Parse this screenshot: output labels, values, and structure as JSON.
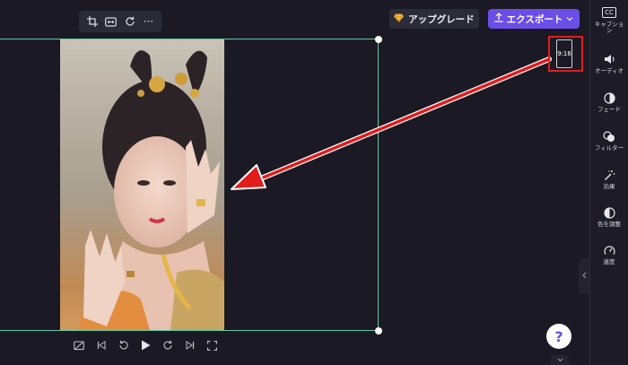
{
  "toolbar": {
    "icons": [
      "crop-icon",
      "fit-icon",
      "rotate-icon",
      "more-icon"
    ],
    "more_label": "···"
  },
  "header": {
    "upgrade_label": "アップグレード",
    "export_label": "エクスポート",
    "accent_color": "#6a4ee6"
  },
  "canvas": {
    "aspect_ratio": "9:16",
    "frame_color": "#63c7a6",
    "highlight_color": "#e01d1d"
  },
  "sidebar": {
    "items": [
      {
        "icon": "captions-icon",
        "label": "キャプション"
      },
      {
        "icon": "audio-icon",
        "label": "オーディオ"
      },
      {
        "icon": "fade-icon",
        "label": "フェード"
      },
      {
        "icon": "filter-icon",
        "label": "フィルター"
      },
      {
        "icon": "effects-icon",
        "label": "効果"
      },
      {
        "icon": "color-adjust-icon",
        "label": "色を調整"
      },
      {
        "icon": "speed-icon",
        "label": "速度"
      }
    ],
    "cc_text": "CC"
  },
  "playback": {
    "icons": [
      "hide-preview-icon",
      "skip-back-icon",
      "rewind-5-icon",
      "play-icon",
      "forward-5-icon",
      "skip-forward-icon",
      "fullscreen-icon"
    ]
  },
  "help": {
    "label": "?"
  }
}
